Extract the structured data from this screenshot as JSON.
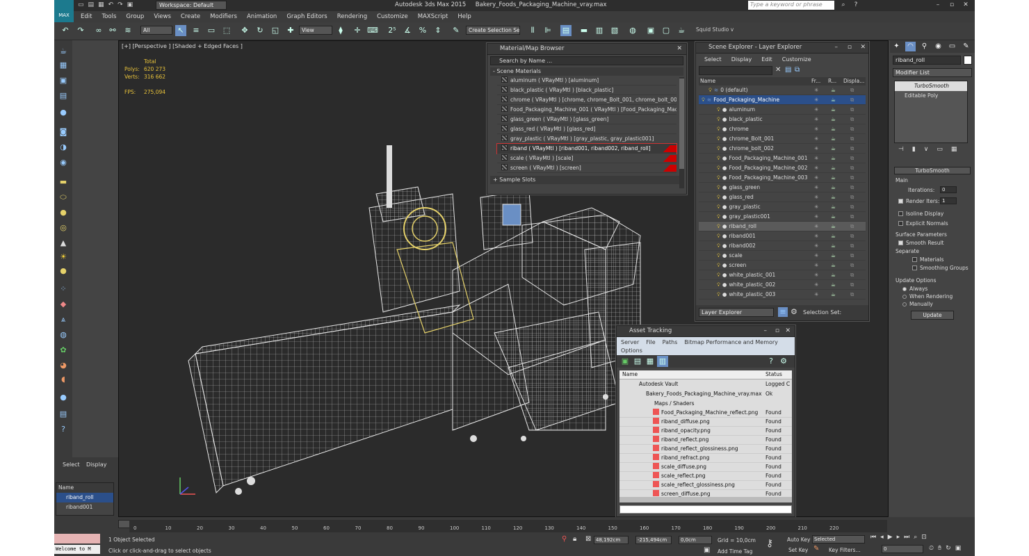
{
  "app": {
    "logo": "MAX",
    "title": "Autodesk 3ds Max 2015",
    "file": "Bakery_Foods_Packaging_Machine_vray.max",
    "workspace": "Workspace: Default",
    "search_placeholder": "Type a keyword or phrase"
  },
  "menu": [
    "Edit",
    "Tools",
    "Group",
    "Views",
    "Create",
    "Modifiers",
    "Animation",
    "Graph Editors",
    "Rendering",
    "Customize",
    "MAXScript",
    "Help"
  ],
  "toolbar": {
    "filter": "All",
    "refcoord": "View",
    "selset": "Create Selection Se",
    "studio": "Squid Studio v"
  },
  "viewport": {
    "label": "[+] [Perspective ] [Shaded + Edged Faces ]",
    "stats_total": "Total",
    "polys_label": "Polys:",
    "polys": "620 273",
    "verts_label": "Verts:",
    "verts": "316 662",
    "fps_label": "FPS:",
    "fps": "275,094"
  },
  "material_browser": {
    "title": "Material/Map Browser",
    "search": "Search by Name ...",
    "section": "- Scene Materials",
    "items": [
      "aluminum  ( VRayMtl ) [aluminum]",
      "black_plastic  ( VRayMtl ) [black_plastic]",
      "chrome  ( VRayMtl ) [chrome, chrome_Bolt_001, chrome_bolt_002]",
      "Food_Packaging_Machine_001  ( VRayMtl ) [Food_Packaging_Mach...",
      "glass_green  ( VRayMtl ) [glass_green]",
      "glass_red  ( VRayMtl ) [glass_red]",
      "gray_plastic  ( VRayMtl ) [gray_plastic, gray_plastic001]",
      "riband  ( VRayMtl ) [riband001, riband002, riband_roll]",
      "scale  ( VRayMtl ) [scale]",
      "screen  ( VRayMtl ) [screen]"
    ],
    "sample_slots": "+ Sample Slots"
  },
  "scene_explorer": {
    "title": "Scene Explorer - Layer Explorer",
    "menu": [
      "Select",
      "Display",
      "Edit",
      "Customize"
    ],
    "col_name": "Name",
    "col_fr": "Fr...",
    "col_r": "R...",
    "col_disp": "Displa...",
    "layer0": "0 (default)",
    "layer_main": "Food_Packaging_Machine",
    "objects": [
      "aluminum",
      "black_plastic",
      "chrome",
      "chrome_Bolt_001",
      "chrome_bolt_002",
      "Food_Packaging_Machine_001",
      "Food_Packaging_Machine_002",
      "Food_Packaging_Machine_003",
      "glass_green",
      "glass_red",
      "gray_plastic",
      "gray_plastic001",
      "riband_roll",
      "riband001",
      "riband002",
      "scale",
      "screen",
      "white_plastic_001",
      "white_plastic_002",
      "white_plastic_003"
    ],
    "footer_mode": "Layer Explorer",
    "footer_selset": "Selection Set:"
  },
  "asset_tracking": {
    "title": "Asset Tracking",
    "menu": [
      "Server",
      "File",
      "Paths",
      "Bitmap Performance and Memory",
      "Options"
    ],
    "col_name": "Name",
    "col_status": "Status",
    "vault": "Autodesk Vault",
    "vault_status": "Logged C",
    "file": "Bakery_Foods_Packaging_Machine_vray.max",
    "file_status": "Ok",
    "maps": "Maps / Shaders",
    "items": [
      "Food_Packaging_Machine_reflect.png",
      "riband_diffuse.png",
      "riband_opacity.png",
      "riband_reflect.png",
      "riband_reflect_glossiness.png",
      "riband_refract.png",
      "scale_diffuse.png",
      "scale_reflect.png",
      "scale_reflect_glossiness.png",
      "screen_diffuse.png"
    ],
    "item_status": "Found"
  },
  "command_panel": {
    "object_name": "riband_roll",
    "modifier_list": "Modifier List",
    "stack": [
      "TurboSmooth",
      "Editable Poly"
    ],
    "rollout": "TurboSmooth",
    "main": "Main",
    "iterations_label": "Iterations:",
    "iterations": "0",
    "render_iters_label": "Render Iters:",
    "render_iters": "1",
    "isoline": "Isoline Display",
    "explicit": "Explicit Normals",
    "surface": "Surface Parameters",
    "smooth_result": "Smooth Result",
    "separate": "Separate",
    "materials": "Materials",
    "smoothing_groups": "Smoothing Groups",
    "update_options": "Update Options",
    "always": "Always",
    "when_rendering": "When Rendering",
    "manually": "Manually",
    "update_btn": "Update"
  },
  "left_panel": {
    "tab_select": "Select",
    "tab_display": "Display",
    "col_name": "Name",
    "rows": [
      "riband_roll",
      "riband001"
    ]
  },
  "timeline": {
    "frame": "0 / 225",
    "ticks": [
      "0",
      "10",
      "20",
      "30",
      "40",
      "50",
      "60",
      "70",
      "80",
      "90",
      "100",
      "110",
      "120",
      "130",
      "140",
      "150",
      "160",
      "170",
      "180",
      "190",
      "200",
      "210",
      "220"
    ]
  },
  "status": {
    "listener": "Welcome to M",
    "selected": "1 Object Selected",
    "hint": "Click or click-and-drag to select objects",
    "x": "48,192cm",
    "y": "-215,494cm",
    "z": "0,0cm",
    "grid": "Grid = 10,0cm",
    "add_time_tag": "Add Time Tag",
    "auto_key": "Auto Key",
    "selected_mode": "Selected",
    "set_key": "Set Key",
    "key_filters": "Key Filters...",
    "frame_field": "0"
  }
}
